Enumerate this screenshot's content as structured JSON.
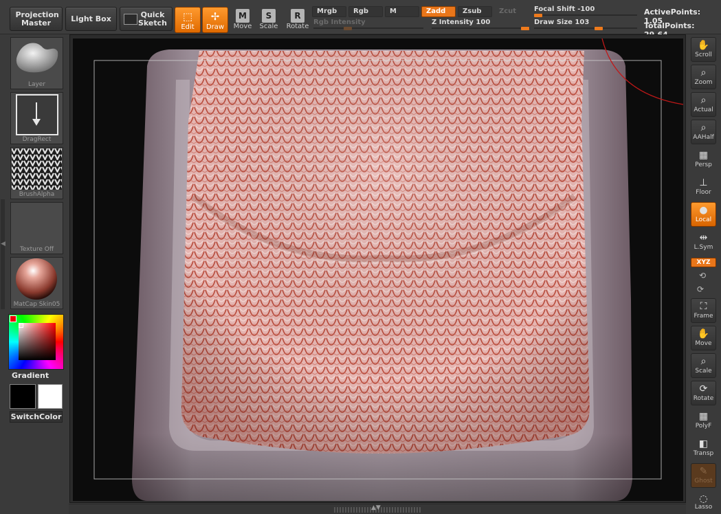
{
  "toolbar": {
    "projection_master": "Projection Master",
    "light_box": "Light Box",
    "quick_sketch": "Quick Sketch",
    "edit": "Edit",
    "draw": "Draw",
    "move": "Move",
    "scale": "Scale",
    "rotate": "Rotate",
    "move_key": "M",
    "scale_key": "S",
    "rotate_key": "R",
    "mrgb": "Mrgb",
    "rgb": "Rgb",
    "m": "M",
    "zadd": "Zadd",
    "zsub": "Zsub",
    "zcut": "Zcut",
    "rgb_intensity": "Rgb Intensity",
    "z_intensity_label": "Z Intensity",
    "z_intensity_value": "100",
    "focal_shift_label": "Focal Shift",
    "focal_shift_value": "-100",
    "draw_size_label": "Draw Size",
    "draw_size_value": "103",
    "active_points": "ActivePoints: 1.05",
    "total_points": "TotalPoints: 29.64"
  },
  "left_shelf": {
    "brush": "Layer",
    "stroke": "DragRect",
    "alpha": "BrushAlpha",
    "texture": "Texture Off",
    "material": "MatCap Skin05",
    "gradient": "Gradient",
    "switch_color": "SwitchColor"
  },
  "right_shelf": {
    "scroll": "Scroll",
    "zoom": "Zoom",
    "actual": "Actual",
    "aahalf": "AAHalf",
    "persp": "Persp",
    "floor": "Floor",
    "local": "Local",
    "lsym": "L.Sym",
    "xyz": "XYZ",
    "frame": "Frame",
    "move": "Move",
    "scale": "Scale",
    "rotate": "Rotate",
    "polyf": "PolyF",
    "transp": "Transp",
    "ghost": "Ghost",
    "lasso": "Lasso"
  },
  "colors": {
    "accent": "#e9761a",
    "background": "#3a3a3a",
    "mesh_base": "#8b7c86",
    "knit_surface": "#e2b0ad"
  }
}
